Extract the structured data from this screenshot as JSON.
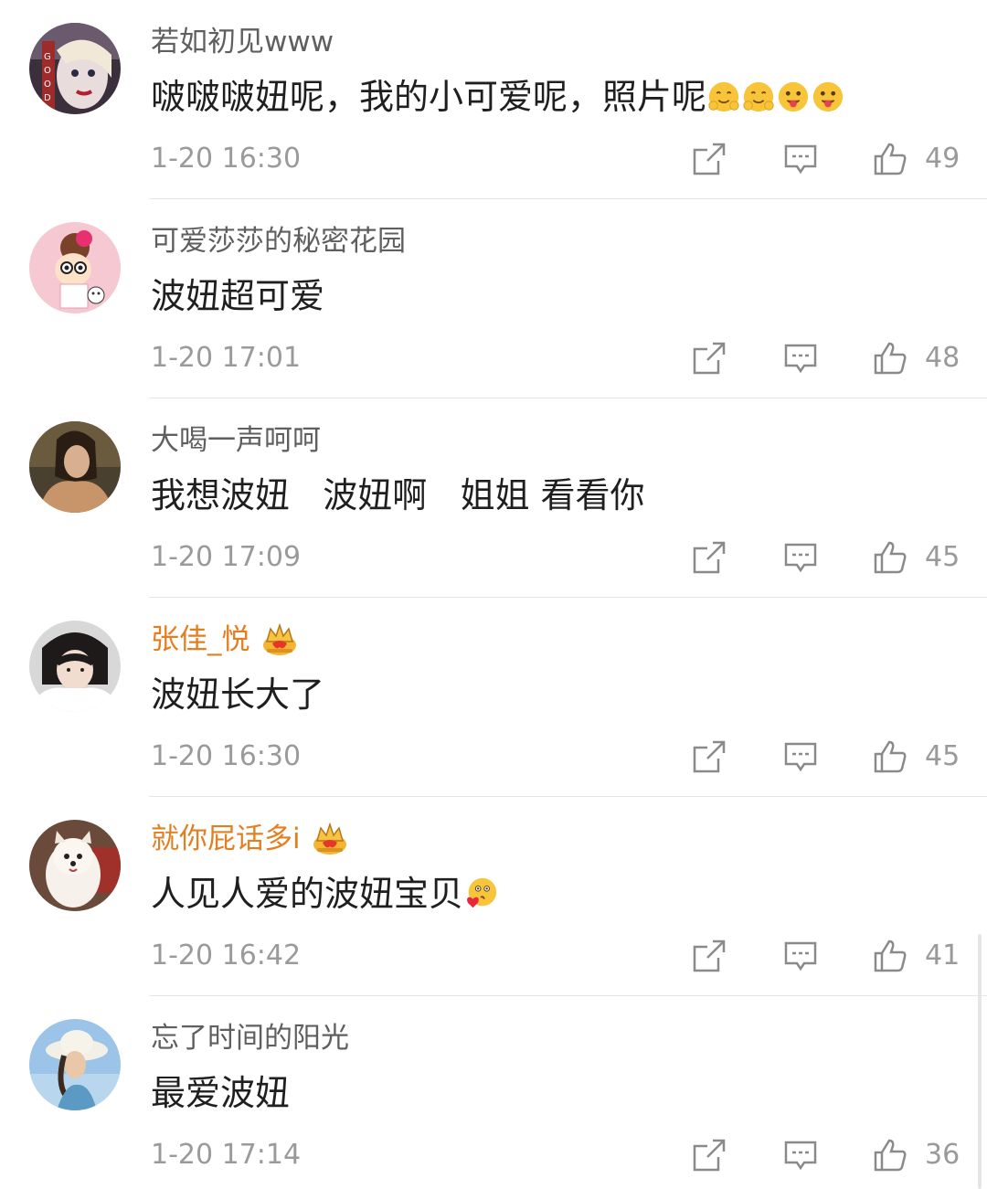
{
  "comments": [
    {
      "username": "若如初见www",
      "vip": false,
      "text": "啵啵啵妞呢，我的小可爱呢，照片呢",
      "emojis": [
        "hug-emoji",
        "hug-emoji",
        "tongue-emoji",
        "tongue-emoji"
      ],
      "time": "1-20 16:30",
      "likes": "49"
    },
    {
      "username": "可爱莎莎的秘密花园",
      "vip": false,
      "text": "波妞超可爱",
      "emojis": [],
      "time": "1-20 17:01",
      "likes": "48"
    },
    {
      "username": "大喝一声呵呵",
      "vip": false,
      "text": "我想波妞   波妞啊   姐姐 看看你",
      "emojis": [],
      "time": "1-20 17:09",
      "likes": "45"
    },
    {
      "username": "张佳_悦",
      "vip": true,
      "text": "波妞长大了",
      "emojis": [],
      "time": "1-20 16:30",
      "likes": "45"
    },
    {
      "username": "就你屁话多i",
      "vip": true,
      "text": "人见人爱的波妞宝贝",
      "emojis": [
        "kiss-heart-emoji"
      ],
      "time": "1-20 16:42",
      "likes": "41"
    },
    {
      "username": "忘了时间的阳光",
      "vip": false,
      "text": "最爱波妞",
      "emojis": [],
      "time": "1-20 17:14",
      "likes": "36"
    }
  ],
  "colors": {
    "username": "#5f5f5f",
    "vip_username": "#e47e1f",
    "meta": "#9a9a9a",
    "text": "#1f1f1f",
    "divider": "#e4e4e4"
  }
}
